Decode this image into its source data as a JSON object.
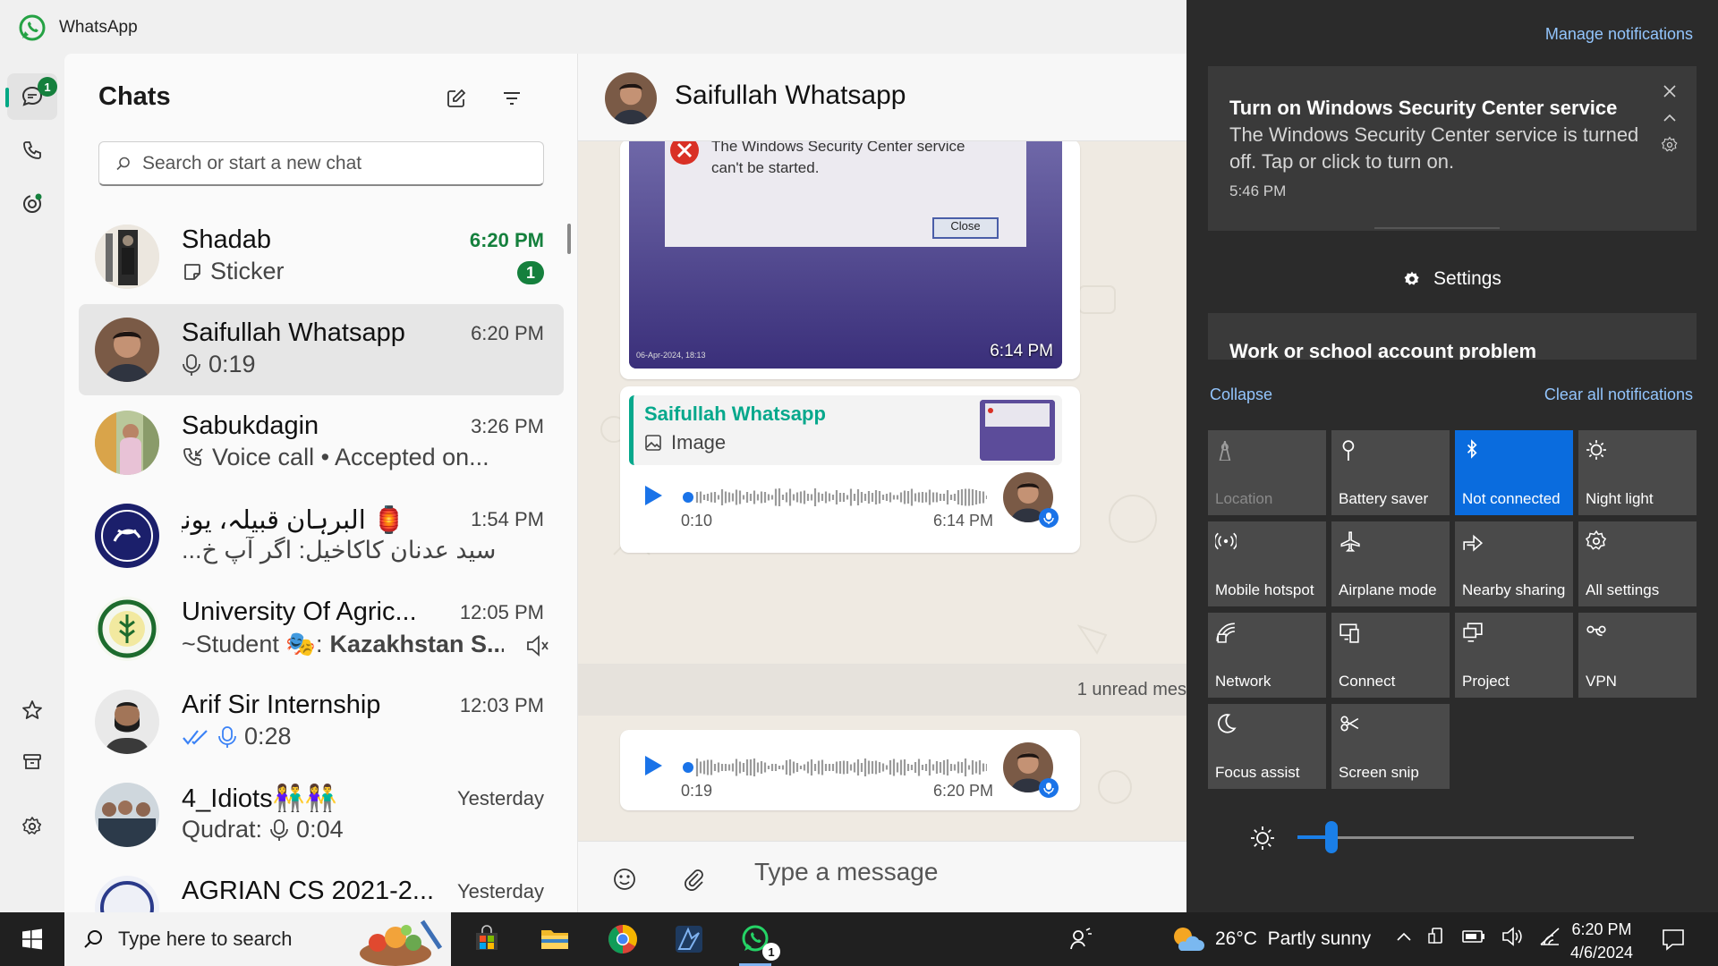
{
  "app": {
    "title": "WhatsApp"
  },
  "rail": {
    "chats_badge": "1"
  },
  "chatlist": {
    "title": "Chats",
    "search_placeholder": "Search or start a new chat",
    "items": [
      {
        "name": "Shadab",
        "time": "6:20 PM",
        "preview": "Sticker",
        "preview_icon": "sticker-icon",
        "unread": "1"
      },
      {
        "name": "Saifullah Whatsapp",
        "time": "6:20 PM",
        "preview": "0:19",
        "preview_icon": "mic-icon"
      },
      {
        "name": "Sabukdagin",
        "time": "3:26 PM",
        "preview": "Voice call • Accepted on...",
        "preview_icon": "incoming-call-icon"
      },
      {
        "name": "البرہان قبیلہ، یونیور...",
        "time": "1:54 PM",
        "preview": "سید عدنان کاکاخیل: اگر آپ خ...",
        "emoji": "🏮"
      },
      {
        "name": "University Of Agric...",
        "time": "12:05 PM",
        "preview_prefix": "~Student 🎭:",
        "preview": "Kazakhstan S...",
        "muted": true
      },
      {
        "name": "Arif Sir Internship",
        "time": "12:03 PM",
        "preview": "0:28",
        "preview_icon": "double-check-mic-icon"
      },
      {
        "name": "4_Idiots👫👫",
        "time": "Yesterday",
        "preview_prefix": "Qudrat:",
        "preview": "0:04",
        "preview_icon": "mic-icon"
      },
      {
        "name": "AGRIAN CS 2021-2...",
        "time": "Yesterday",
        "preview": ""
      }
    ]
  },
  "conversation": {
    "name": "Saifullah Whatsapp",
    "image_message": {
      "dialog_text_1": "The Windows Security Center service",
      "dialog_text_2": "can't be started.",
      "dialog_button": "Close",
      "photo_stamp": "06-Apr-2024, 18:13",
      "time": "6:14 PM"
    },
    "reply_message": {
      "quote_name": "Saifullah Whatsapp",
      "quote_text": "Image",
      "audio_duration": "0:10",
      "time": "6:14 PM"
    },
    "unread_banner": "1 unread mes",
    "audio_message": {
      "duration": "0:19",
      "time": "6:20 PM"
    },
    "composer_placeholder": "Type a message"
  },
  "action_center": {
    "manage_link": "Manage notifications",
    "notification": {
      "title": "Turn on Windows Security Center service",
      "body": "The Windows Security Center service is turned off. Tap or click to turn on.",
      "time": "5:46 PM"
    },
    "group_label": "Settings",
    "notification2": {
      "title": "Work or school account problem"
    },
    "collapse": "Collapse",
    "clear_all": "Clear all notifications",
    "tiles": [
      {
        "label": "Location",
        "icon": "location-icon",
        "state": "disabled"
      },
      {
        "label": "Battery saver",
        "icon": "battery-saver-icon",
        "state": "off"
      },
      {
        "label": "Not connected",
        "icon": "bluetooth-icon",
        "state": "on"
      },
      {
        "label": "Night light",
        "icon": "night-light-icon",
        "state": "off"
      },
      {
        "label": "Mobile hotspot",
        "icon": "hotspot-icon",
        "state": "off"
      },
      {
        "label": "Airplane mode",
        "icon": "airplane-icon",
        "state": "off"
      },
      {
        "label": "Nearby sharing",
        "icon": "nearby-share-icon",
        "state": "off"
      },
      {
        "label": "All settings",
        "icon": "gear-icon",
        "state": "off"
      },
      {
        "label": "Network",
        "icon": "network-icon",
        "state": "off"
      },
      {
        "label": "Connect",
        "icon": "connect-icon",
        "state": "off"
      },
      {
        "label": "Project",
        "icon": "project-icon",
        "state": "off"
      },
      {
        "label": "VPN",
        "icon": "vpn-icon",
        "state": "off"
      },
      {
        "label": "Focus assist",
        "icon": "moon-icon",
        "state": "off"
      },
      {
        "label": "Screen snip",
        "icon": "screen-snip-icon",
        "state": "off"
      }
    ],
    "brightness_level": 0.1
  },
  "taskbar": {
    "search_placeholder": "Type here to search",
    "whatsapp_badge": "1",
    "weather": "26°C  Partly sunny",
    "time": "6:20 PM",
    "date": "4/6/2024"
  },
  "colors": {
    "accent_green": "#15803d",
    "teal": "#06a88c",
    "win_blue": "#0a6cde"
  }
}
